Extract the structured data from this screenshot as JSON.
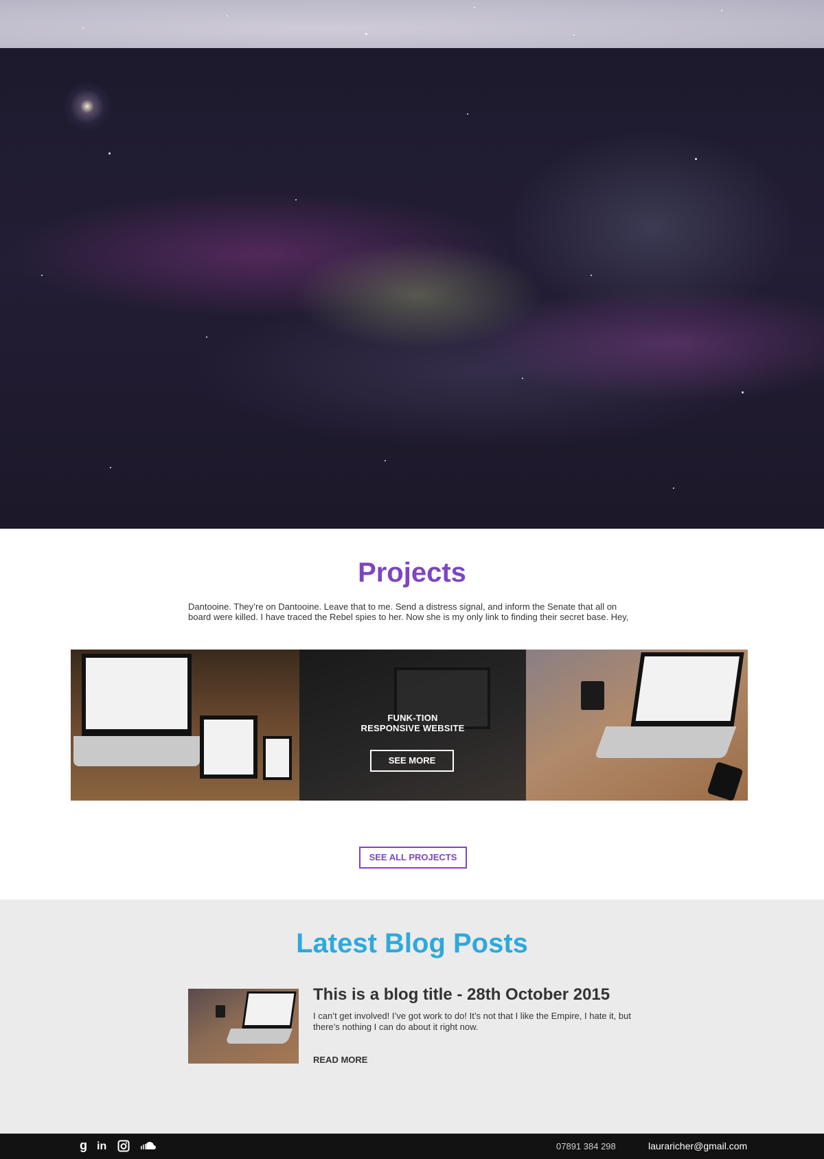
{
  "projects": {
    "title": "Projects",
    "description": "Dantooine. They’re on Dantooine. Leave that to me. Send a distress signal, and inform the Senate that all on board were killed. I have traced the Rebel spies to her. Now she is my only link to finding their secret base. Hey,",
    "featured": {
      "caption_line1": "FUNK-TION",
      "caption_line2": "RESPONSIVE WEBSITE",
      "button_label": "SEE MORE"
    },
    "see_all_label": "SEE ALL PROJECTS"
  },
  "blog": {
    "title": "Latest Blog Posts",
    "post": {
      "title": "This is a blog title - 28th October 2015",
      "excerpt": "I can’t get involved! I’ve got work to do! It’s not that I like the Empire, I hate it, but there’s nothing I can do about it right now.",
      "read_more": "READ MORE"
    }
  },
  "footer": {
    "social": [
      {
        "icon": "google-plus-icon"
      },
      {
        "icon": "linkedin-icon"
      },
      {
        "icon": "instagram-icon"
      },
      {
        "icon": "soundcloud-icon"
      }
    ],
    "phone": "07891 384 298",
    "email": "lauraricher@gmail.com"
  },
  "colors": {
    "projects_accent": "#7d45c4",
    "blog_accent": "#2ea9d9",
    "footer_bg": "#121212",
    "blog_bg": "#ebebeb"
  }
}
